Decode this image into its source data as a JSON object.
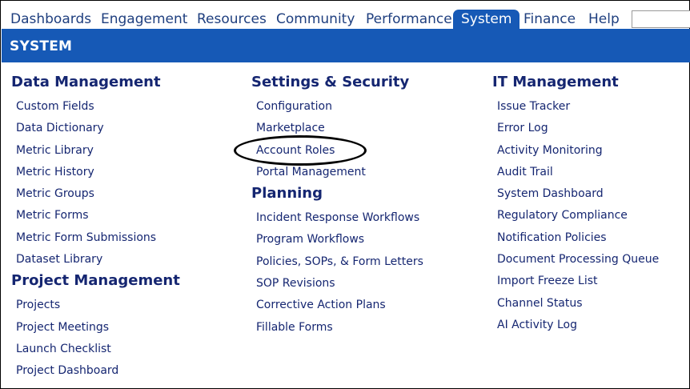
{
  "nav": {
    "tabs": [
      {
        "label": "Dashboards",
        "active": false
      },
      {
        "label": "Engagement",
        "active": false
      },
      {
        "label": "Resources",
        "active": false
      },
      {
        "label": "Community",
        "active": false
      },
      {
        "label": "Performance",
        "active": false
      },
      {
        "label": "System",
        "active": true
      },
      {
        "label": "Finance",
        "active": false
      },
      {
        "label": "Help",
        "active": false
      }
    ],
    "search_value": ""
  },
  "section_title": "SYSTEM",
  "columns": [
    {
      "groups": [
        {
          "title": "Data Management",
          "links": [
            "Custom Fields",
            "Data Dictionary",
            "Metric Library",
            "Metric History",
            "Metric Groups",
            "Metric Forms",
            "Metric Form Submissions",
            "Dataset Library"
          ]
        },
        {
          "title": "Project Management",
          "links": [
            "Projects",
            "Project Meetings",
            "Launch Checklist",
            "Project Dashboard"
          ]
        }
      ]
    },
    {
      "groups": [
        {
          "title": "Settings & Security",
          "links": [
            "Configuration",
            "Marketplace",
            "Account Roles",
            "Portal Management"
          ]
        },
        {
          "title": "Planning",
          "links": [
            "Incident Response Workflows",
            "Program Workflows",
            "Policies, SOPs, & Form Letters",
            "SOP Revisions",
            "Corrective Action Plans",
            "Fillable Forms"
          ]
        }
      ]
    },
    {
      "groups": [
        {
          "title": "IT Management",
          "links": [
            "Issue Tracker",
            "Error Log",
            "Activity Monitoring",
            "Audit Trail",
            "System Dashboard",
            "Regulatory Compliance",
            "Notification Policies",
            "Document Processing Queue",
            "Import Freeze List",
            "Channel Status",
            "AI Activity Log"
          ]
        }
      ]
    }
  ],
  "annotation": {
    "circled_item": "Account Roles"
  },
  "colors": {
    "nav_blue": "#1659b6",
    "link_navy": "#152671",
    "tab_text": "#1f3f7f"
  }
}
